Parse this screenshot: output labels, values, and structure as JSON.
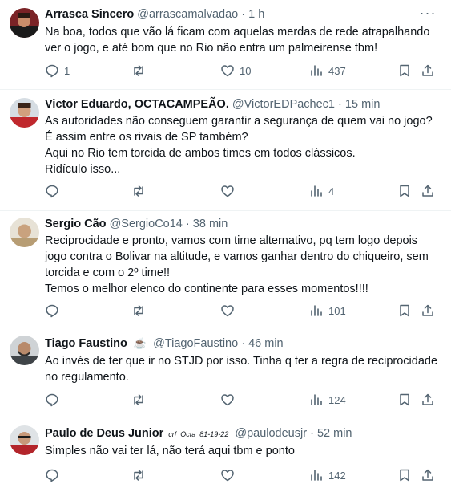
{
  "tweets": [
    {
      "name": "Arrasca Sincero",
      "handle": "@arrascamalvadao",
      "time": "1 h",
      "lines": [
        "Na boa, todos que vão lá ficam com aquelas merdas de rede atrapalhando",
        "ver o jogo, e até bom que no Rio não entra um palmeirense tbm!"
      ],
      "replies": "1",
      "retweets": "",
      "likes": "10",
      "views": "437",
      "avatar_color": "#7a2326"
    },
    {
      "name": "Victor Eduardo, OCTACAMPEÃO.",
      "handle": "@VictorEDPachec1",
      "time": "15 min",
      "lines": [
        "As autoridades não conseguem garantir a segurança de quem vai no jogo?",
        "É assim entre os rivais de SP também?",
        "Aqui no Rio tem torcida de ambos times em todos clássicos.",
        "Ridículo isso..."
      ],
      "replies": "",
      "retweets": "",
      "likes": "",
      "views": "4",
      "avatar_color": "#c0282d"
    },
    {
      "name": "Sergio Cão",
      "handle": "@SergioCo14",
      "time": "38 min",
      "lines": [
        "Reciprocidade e pronto, vamos com time alternativo, pq tem logo depois",
        "jogo contra o Bolivar na altitude, e vamos ganhar dentro do chiqueiro, sem",
        "torcida e com o 2º time!!",
        "Temos o melhor elenco do continente para esses momentos!!!!"
      ],
      "replies": "",
      "retweets": "",
      "likes": "",
      "views": "101",
      "avatar_color": "#c9b48f"
    },
    {
      "name": "Tiago Faustino",
      "emoji": "☕",
      "handle": "@TiagoFaustino",
      "time": "46 min",
      "lines": [
        "Ao invés de ter que ir no STJD por isso. Tinha q ter a regra de reciprocidade",
        "no regulamento."
      ],
      "replies": "",
      "retweets": "",
      "likes": "",
      "views": "124",
      "avatar_color": "#3f4448"
    },
    {
      "name": "Paulo de Deus Junior",
      "badge": "crf_Octa_81-19-22",
      "handle": "@paulodeusjr",
      "time": "52 min",
      "lines": [
        "Simples não vai ter lá, não terá aqui tbm e ponto"
      ],
      "replies": "",
      "retweets": "",
      "likes": "",
      "views": "142",
      "avatar_color": "#b3252b"
    }
  ],
  "sep": "·",
  "more_label": "···"
}
